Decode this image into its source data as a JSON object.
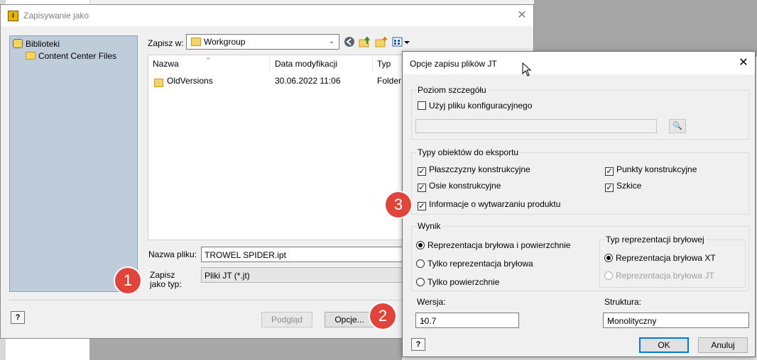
{
  "save_dialog": {
    "title": "Zapisywanie jako",
    "places": [
      "Biblioteki",
      "Content Center Files"
    ],
    "save_in_label": "Zapisz w:",
    "save_in_value": "Workgroup",
    "columns": [
      "Nazwa",
      "Data modyfikacji",
      "Typ"
    ],
    "rows": [
      {
        "name": "OldVersions",
        "date": "30.06.2022 11:06",
        "type": "Folder"
      }
    ],
    "filename_label": "Nazwa pliku:",
    "filename_value": "TROWEL SPIDER.ipt",
    "filetype_label": "Zapisz jako typ:",
    "filetype_value": "Pliki JT (*.jt)",
    "preview_label": "Podgląd",
    "options_label": "Opcje...",
    "help_label": "?"
  },
  "jt_dialog": {
    "title": "Opcje zapisu plików JT",
    "detail_group": "Poziom szczegółu",
    "use_config_label": "Użyj pliku konfiguracyjnego",
    "use_config_checked": false,
    "export_group": "Typy obiektów do eksportu",
    "export_items": [
      {
        "label": "Płaszczyzny konstrukcyjne",
        "checked": true
      },
      {
        "label": "Punkty konstrukcyjne",
        "checked": true
      },
      {
        "label": "Osie konstrukcyjne",
        "checked": true
      },
      {
        "label": "Szkice",
        "checked": true
      },
      {
        "label": "Informacje o wytwarzaniu produktu",
        "checked": true
      }
    ],
    "output_group": "Wynik",
    "output_options": [
      {
        "label": "Reprezentacja bryłowa i powierzchnie",
        "selected": true
      },
      {
        "label": "Tylko reprezentacja bryłowa",
        "selected": false
      },
      {
        "label": "Tylko powierzchnie",
        "selected": false
      }
    ],
    "solid_group": "Typ reprezentacji bryłowej",
    "solid_options": [
      {
        "label": "Reprezentacja bryłowa XT",
        "selected": true,
        "enabled": true
      },
      {
        "label": "Reprezentacja bryłowa JT",
        "selected": false,
        "enabled": false
      }
    ],
    "version_label": "Wersja:",
    "version_value": "10.7",
    "structure_label": "Struktura:",
    "structure_value": "Monolityczny",
    "ok_label": "OK",
    "cancel_label": "Anuluj",
    "help_label": "?"
  },
  "callouts": [
    "1",
    "2",
    "3"
  ],
  "colors": {
    "callout": "#e0443a",
    "places_bg": "#bfcddb",
    "default_button_border": "#0078d7"
  },
  "icons": [
    "app-icon",
    "close-icon",
    "library-icon",
    "folder-icon",
    "back-icon",
    "up-folder-icon",
    "new-folder-icon",
    "view-menu-icon",
    "browse-icon",
    "help-icon",
    "mouse-cursor-icon"
  ]
}
